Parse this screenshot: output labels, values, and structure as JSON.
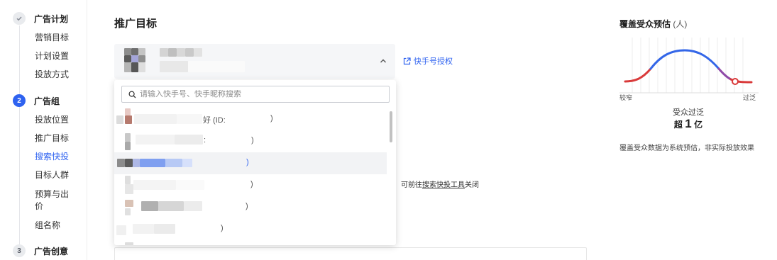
{
  "sidebar": {
    "steps": [
      {
        "marker": "✓",
        "title": "广告计划",
        "items": [
          "营销目标",
          "计划设置",
          "投放方式"
        ]
      },
      {
        "marker": "2",
        "title": "广告组",
        "items": [
          "投放位置",
          "推广目标",
          "搜索快投",
          "目标人群",
          "预算与出",
          "价",
          "组名称"
        ]
      },
      {
        "marker": "3",
        "title": "广告创意",
        "items": []
      }
    ],
    "active_item": "搜索快投"
  },
  "main": {
    "section_title": "推广目标",
    "auth_link": "快手号授权",
    "tip": {
      "prefix": "可前往",
      "link": "搜索快投工具",
      "suffix": "关闭"
    }
  },
  "dropdown": {
    "search_placeholder": "请输入快手号、快手昵称搜索",
    "items": [
      {
        "fragment": "好 (ID:",
        "close": ")"
      },
      {
        "fragment": ":",
        "close": ")"
      },
      {
        "fragment": "",
        "close": ")"
      },
      {
        "fragment": "",
        "close": ")"
      },
      {
        "fragment": "",
        "close": ")"
      },
      {
        "fragment": "",
        "close": ")"
      }
    ]
  },
  "audience": {
    "title": "覆盖受众预估",
    "unit": "(人)",
    "left_label": "较窄",
    "right_label": "过泛",
    "status": "受众过泛",
    "count_prefix": "超",
    "count_number": "1",
    "count_unit": "亿",
    "note": "覆盖受众数据为系统预估，非实际投放效果"
  },
  "colors": {
    "accent": "#2e62f0",
    "curve_narrow": "#d93a3a",
    "curve_good": "#3366e8"
  },
  "icons": {
    "done": "check-icon",
    "expand": "chevron-up-icon",
    "link": "external-link-icon",
    "search": "search-icon"
  }
}
